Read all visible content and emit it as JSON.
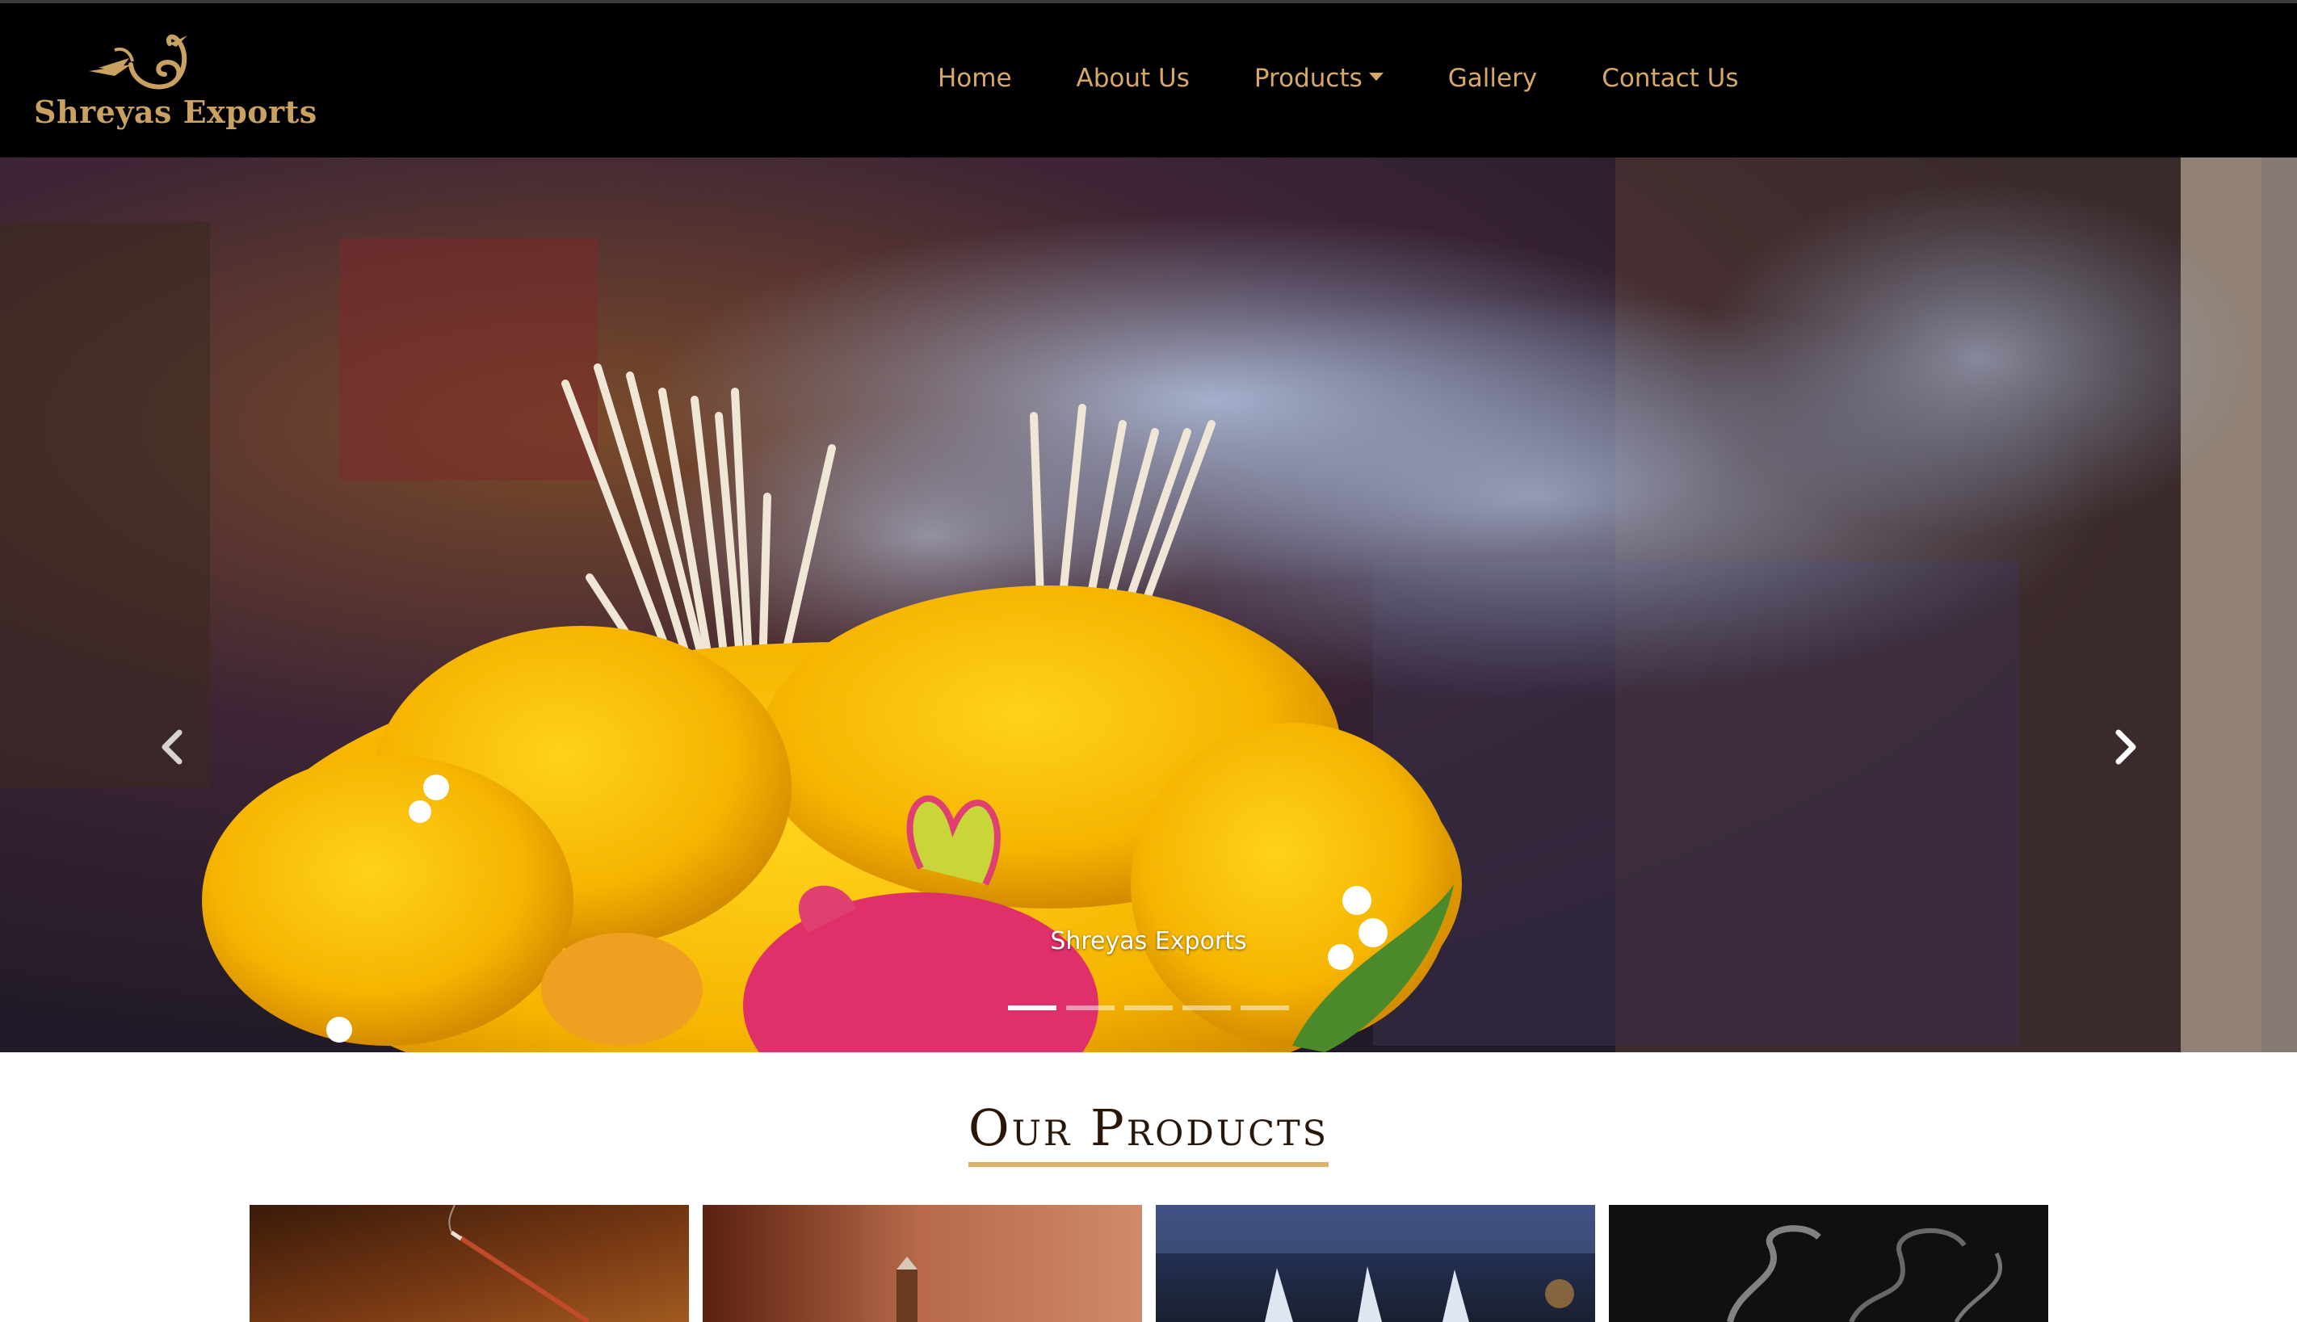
{
  "brand": {
    "name": "Shreyas Exports"
  },
  "nav": {
    "items": [
      {
        "label": "Home"
      },
      {
        "label": "About Us"
      },
      {
        "label": "Products",
        "has_dropdown": true
      },
      {
        "label": "Gallery"
      },
      {
        "label": "Contact Us"
      }
    ]
  },
  "hero": {
    "caption": "Shreyas Exports",
    "slides_count": 5,
    "active_slide": 1
  },
  "products": {
    "title": "Our Products"
  },
  "colors": {
    "nav_background": "#000000",
    "accent_gold": "#d6a968",
    "title_underline": "#d9b066"
  }
}
